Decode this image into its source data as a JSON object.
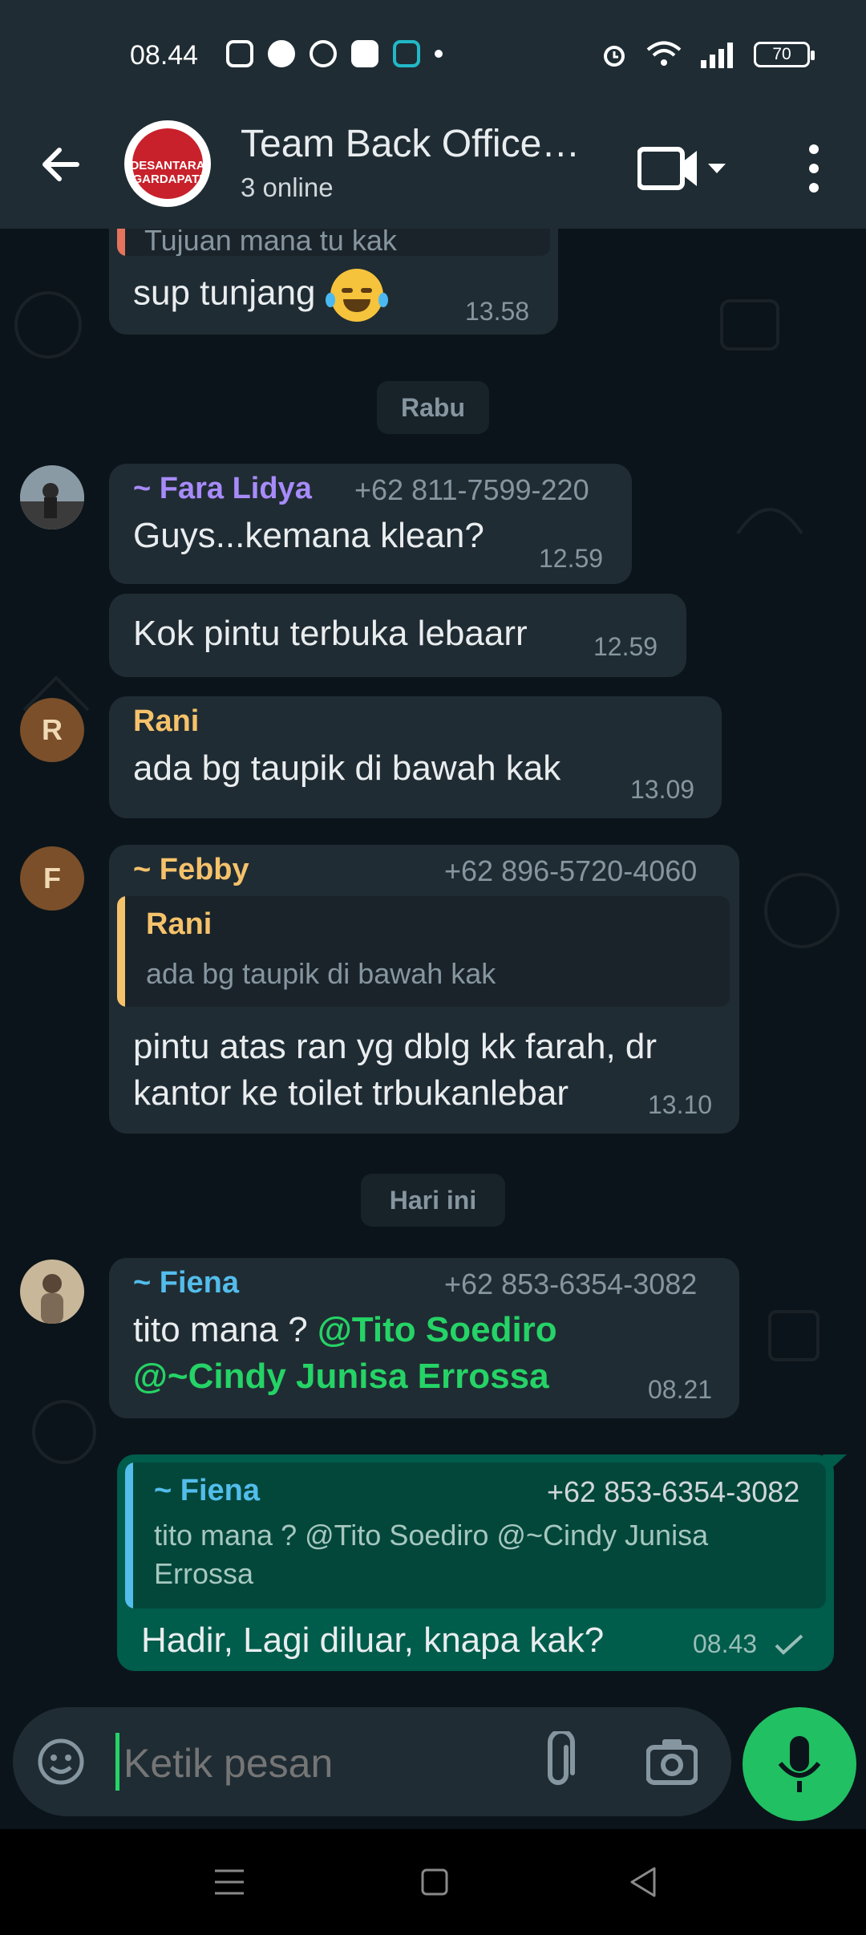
{
  "status_bar": {
    "time": "08.44",
    "battery": "70"
  },
  "header": {
    "title": "Team Back Office…",
    "subtitle": "3 online",
    "group_logo_text": "DESANTARA GARDAPATI"
  },
  "messages": [
    {
      "quote_partial": "Tujuan mana tu kak",
      "text": "sup tunjang",
      "time": "13.58"
    },
    {
      "day": "Rabu"
    },
    {
      "sender": "~ Fara Lidya",
      "phone": "+62 811-7599-220",
      "text": "Guys...kemana klean?",
      "time": "12.59"
    },
    {
      "text": "Kok pintu terbuka lebaarr",
      "time": "12.59"
    },
    {
      "sender": "Rani",
      "avatar_letter": "R",
      "text": "ada bg taupik di bawah kak",
      "time": "13.09"
    },
    {
      "sender": "~ Febby",
      "avatar_letter": "F",
      "phone": "+62 896-5720-4060",
      "quote_sender": "Rani",
      "quote_text": "ada bg taupik di bawah kak",
      "text_line1": "pintu atas ran yg dblg kk farah, dr",
      "text_line2": "kantor ke toilet trbukanlebar",
      "time": "13.10"
    },
    {
      "day": "Hari ini"
    },
    {
      "sender": "~ Fiena",
      "phone": "+62 853-6354-3082",
      "text_prefix": "tito mana ? ",
      "mention1": "@Tito Soediro",
      "mention2": "@~Cindy Junisa Errossa",
      "time": "08.21"
    },
    {
      "quote_sender": "~ Fiena",
      "quote_phone": "+62 853-6354-3082",
      "quote_text_line1": "tito mana ? @Tito Soediro @~Cindy Junisa",
      "quote_text_line2": "Errossa",
      "text": "Hadir, Lagi diluar, knapa kak?",
      "time": "08.43"
    }
  ],
  "composer": {
    "placeholder": "Ketik pesan"
  },
  "colors": {
    "accent": "#25d366",
    "header_bg": "#1f2c34",
    "chat_bg": "#0b141a",
    "incoming_bubble": "#202c33",
    "outgoing_bubble": "#005c4b"
  }
}
